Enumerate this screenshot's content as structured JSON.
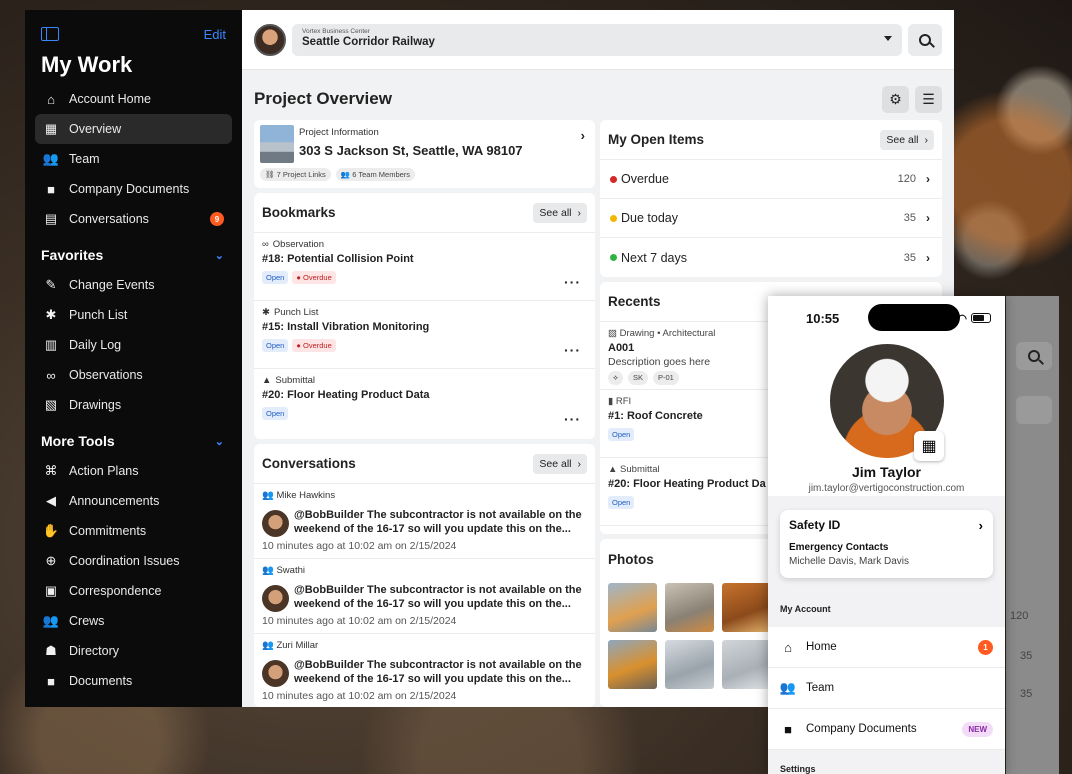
{
  "sidebar": {
    "edit_label": "Edit",
    "title": "My Work",
    "primary": [
      {
        "label": "Account Home",
        "icon": "home-icon"
      },
      {
        "label": "Overview",
        "icon": "building-icon"
      },
      {
        "label": "Team",
        "icon": "team-icon"
      },
      {
        "label": "Company Documents",
        "icon": "folder-icon"
      },
      {
        "label": "Conversations",
        "icon": "chat-icon",
        "badge": "9"
      }
    ],
    "favorites_label": "Favorites",
    "favorites": [
      {
        "label": "Change Events",
        "icon": "change-events-icon"
      },
      {
        "label": "Punch List",
        "icon": "punch-list-icon"
      },
      {
        "label": "Daily Log",
        "icon": "daily-log-icon"
      },
      {
        "label": "Observations",
        "icon": "binoculars-icon"
      },
      {
        "label": "Drawings",
        "icon": "drawings-icon"
      }
    ],
    "more_tools_label": "More Tools",
    "more_tools": [
      {
        "label": "Action Plans",
        "icon": "action-plans-icon"
      },
      {
        "label": "Announcements",
        "icon": "megaphone-icon"
      },
      {
        "label": "Commitments",
        "icon": "handshake-icon"
      },
      {
        "label": "Coordination Issues",
        "icon": "coordination-icon"
      },
      {
        "label": "Correspondence",
        "icon": "correspondence-icon"
      },
      {
        "label": "Crews",
        "icon": "crews-icon"
      },
      {
        "label": "Directory",
        "icon": "directory-icon"
      },
      {
        "label": "Documents",
        "icon": "folder-icon"
      }
    ]
  },
  "topbar": {
    "company": "Vortex Business Center",
    "project": "Seattle Corridor Railway"
  },
  "page_title": "Project Overview",
  "project_info": {
    "label": "Project Information",
    "address": "303 S Jackson St, Seattle, WA 98107",
    "links_chip": "7 Project Links",
    "members_chip": "6 Team Members"
  },
  "see_all": "See all",
  "bookmarks": {
    "title": "Bookmarks",
    "items": [
      {
        "type": "Observation",
        "title": "#18: Potential Collision Point",
        "status": "Open",
        "flag": "Overdue"
      },
      {
        "type": "Punch List",
        "title": "#15: Install Vibration Monitoring",
        "status": "Open",
        "flag": "Overdue"
      },
      {
        "type": "Submittal",
        "title": "#20: Floor Heating Product Data",
        "status": "Open",
        "flag": ""
      }
    ]
  },
  "conversations": {
    "title": "Conversations",
    "items": [
      {
        "name": "Mike Hawkins",
        "text": "@BobBuilder The subcontractor is not available on the weekend of the 16-17 so will you update this on the...",
        "time": "10 minutes ago at 10:02 am on 2/15/2024"
      },
      {
        "name": "Swathi",
        "text": "@BobBuilder The subcontractor is not available on the weekend of the 16-17 so will you update this on the...",
        "time": "10 minutes ago at 10:02 am on 2/15/2024"
      },
      {
        "name": "Zuri Millar",
        "text": "@BobBuilder The subcontractor is not available on the weekend of the 16-17 so will you update this on the...",
        "time": "10 minutes ago at 10:02 am on 2/15/2024"
      }
    ]
  },
  "open_items": {
    "title": "My Open Items",
    "rows": [
      {
        "label": "Overdue",
        "count": "120",
        "color": "#d62828"
      },
      {
        "label": "Due today",
        "count": "35",
        "color": "#f2b705"
      },
      {
        "label": "Next 7 days",
        "count": "35",
        "color": "#2fb344"
      }
    ]
  },
  "recents": {
    "title": "Recents",
    "items": [
      {
        "type": "Drawing • Architectural",
        "title": "A001",
        "desc": "Description goes here",
        "chips": [
          "SK",
          "P-01"
        ]
      },
      {
        "type": "RFI",
        "title": "#1: Roof Concrete",
        "status": "Open"
      },
      {
        "type": "Submittal",
        "title": "#20: Floor Heating Product Da",
        "status": "Open"
      }
    ]
  },
  "photos_title": "Photos",
  "phone": {
    "time": "10:55",
    "name": "Jim Taylor",
    "email": "jim.taylor@vertigoconstruction.com",
    "safety_title": "Safety ID",
    "emergency_label": "Emergency Contacts",
    "emergency_names": "Michelle Davis, Mark Davis",
    "my_account_label": "My Account",
    "items": [
      {
        "label": "Home",
        "icon": "home-icon",
        "badge": "1"
      },
      {
        "label": "Team",
        "icon": "team-icon"
      },
      {
        "label": "Company Documents",
        "icon": "folder-icon",
        "tag": "NEW"
      }
    ],
    "settings_label": "Settings"
  },
  "ghost_counts": [
    "120",
    "35",
    "35"
  ],
  "colors": {
    "accent": "#3a86ff",
    "badge": "#ff5a1f",
    "sidebar_bg": "#0b0b0b"
  }
}
